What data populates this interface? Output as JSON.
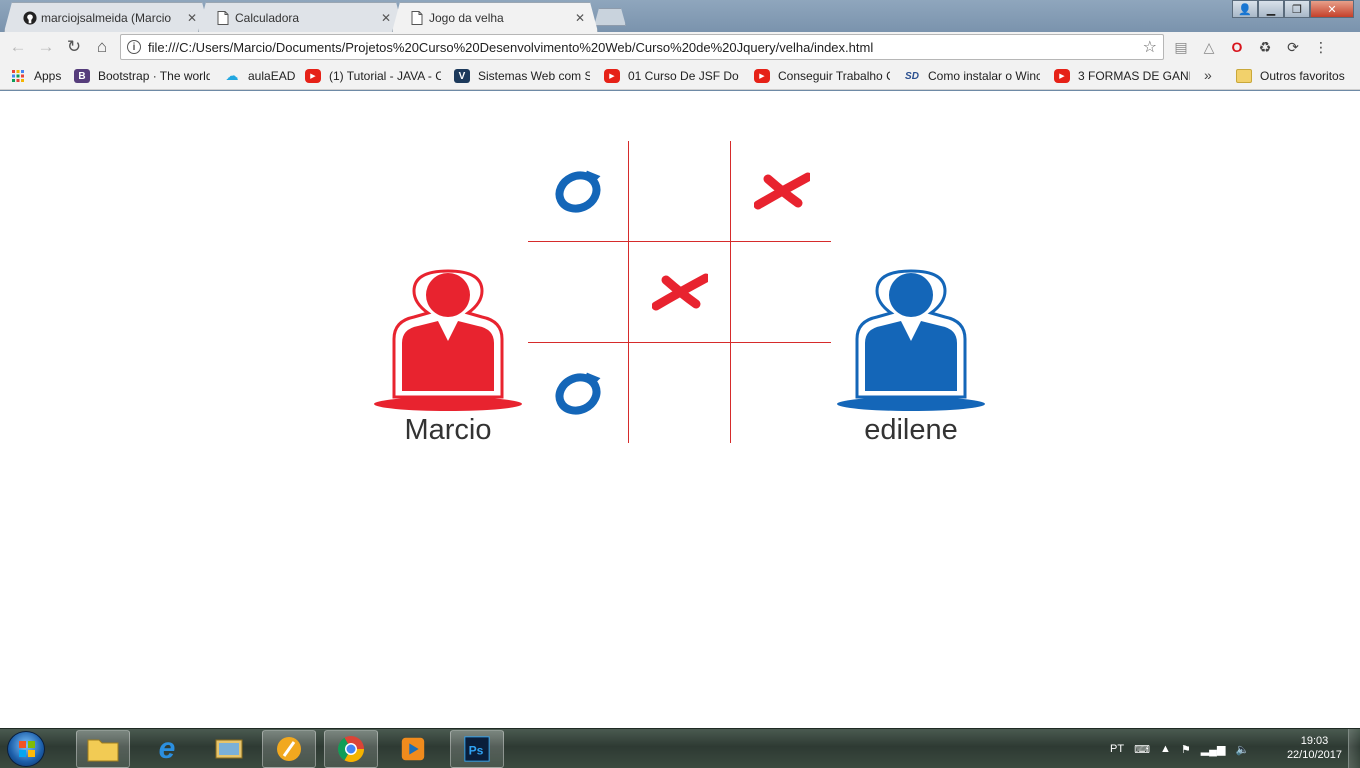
{
  "browser": {
    "tabs": [
      {
        "label": "marciojsalmeida (Marcio",
        "icon": "github-icon"
      },
      {
        "label": "Calculadora",
        "icon": "document-icon"
      },
      {
        "label": "Jogo da velha",
        "icon": "document-icon"
      }
    ],
    "address": "file:///C:/Users/Marcio/Documents/Projetos%20Curso%20Desenvolvimento%20Web/Curso%20de%20Jquery/velha/index.html",
    "bookmarks": [
      {
        "label": "Apps",
        "icon": "apps-grid-icon"
      },
      {
        "label": "Bootstrap · The world",
        "icon": "bootstrap-icon"
      },
      {
        "label": "aulaEAD",
        "icon": "cloud-icon"
      },
      {
        "label": "(1) Tutorial - JAVA - C",
        "icon": "youtube-icon"
      },
      {
        "label": "Sistemas Web com Sp",
        "icon": "sw-icon"
      },
      {
        "label": "01 Curso De JSF Do Z",
        "icon": "youtube-icon"
      },
      {
        "label": "Conseguir Trabalho C",
        "icon": "youtube-icon"
      },
      {
        "label": "Como instalar o Winc",
        "icon": "sd-icon"
      },
      {
        "label": "3 FORMAS DE GANH",
        "icon": "youtube-icon"
      }
    ],
    "more_label": "»",
    "other_bookmarks": "Outros favoritos"
  },
  "game": {
    "board": [
      [
        "O",
        "",
        "X"
      ],
      [
        "",
        "X",
        ""
      ],
      [
        "O",
        "",
        ""
      ]
    ],
    "colors": {
      "x": "#e8232f",
      "o": "#1466b8",
      "grid": "#d62b2b"
    }
  },
  "players": [
    {
      "name": "Marcio",
      "color": "#e8232f"
    },
    {
      "name": "edilene",
      "color": "#1466b8"
    }
  ],
  "taskbar": {
    "lang": "PT",
    "time": "19:03",
    "date": "22/10/2017"
  }
}
